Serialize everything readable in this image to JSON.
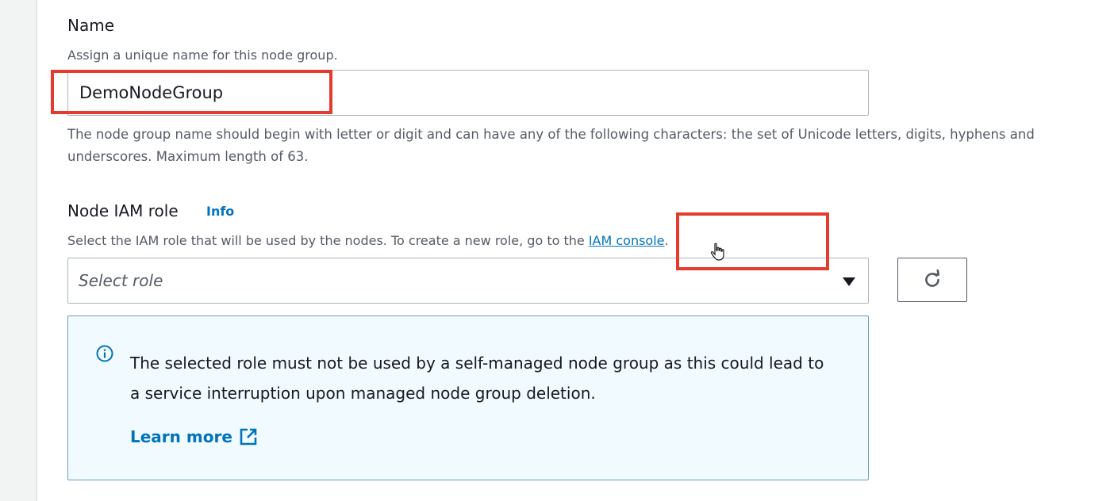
{
  "name_section": {
    "label": "Name",
    "description": "Assign a unique name for this node group.",
    "input_value": "DemoNodeGroup",
    "help_text": "The node group name should begin with letter or digit and can have any of the following characters: the set of Unicode letters, digits, hyphens and underscores. Maximum length of 63."
  },
  "role_section": {
    "label": "Node IAM role",
    "info_link": "Info",
    "description_prefix": "Select the IAM role that will be used by the nodes. To create a new role, go to the ",
    "description_link": "IAM console",
    "description_suffix": ".",
    "select_placeholder": "Select role"
  },
  "alert": {
    "message": "The selected role must not be used by a self-managed node group as this could lead to a service interruption upon managed node group deletion.",
    "learn_more": "Learn more"
  },
  "colors": {
    "link": "#0073bb",
    "highlight": "#e33b2e",
    "alert_bg": "#f1faff"
  }
}
